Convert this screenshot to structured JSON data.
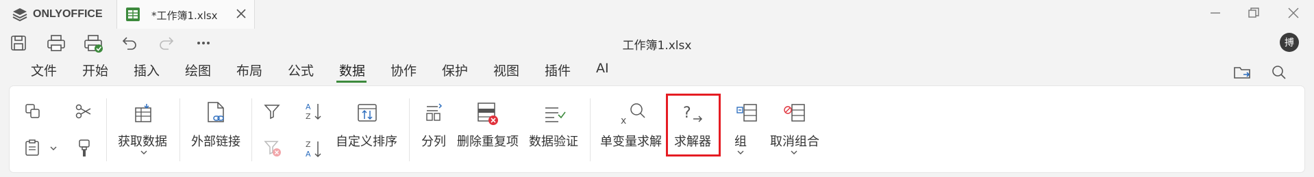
{
  "brand": {
    "name": "ONLYOFFICE"
  },
  "tab": {
    "title": "*工作簿1.xlsx"
  },
  "document": {
    "title": "工作簿1.xlsx"
  },
  "user": {
    "avatar_initial": "搏"
  },
  "menu": {
    "items": [
      "文件",
      "开始",
      "插入",
      "绘图",
      "布局",
      "公式",
      "数据",
      "协作",
      "保护",
      "视图",
      "插件",
      "AI"
    ],
    "active": "数据"
  },
  "ribbon": {
    "get_data": "获取数据",
    "external_links": "外部链接",
    "custom_sort": "自定义排序",
    "split_column": "分列",
    "remove_duplicates": "删除重复项",
    "data_validation": "数据验证",
    "goal_seek": "单变量求解",
    "solver": "求解器",
    "group": "组",
    "ungroup": "取消组合"
  },
  "colors": {
    "accent_green": "#3d8a3d",
    "highlight_red": "#e51c23",
    "error_red": "#e0323c"
  }
}
